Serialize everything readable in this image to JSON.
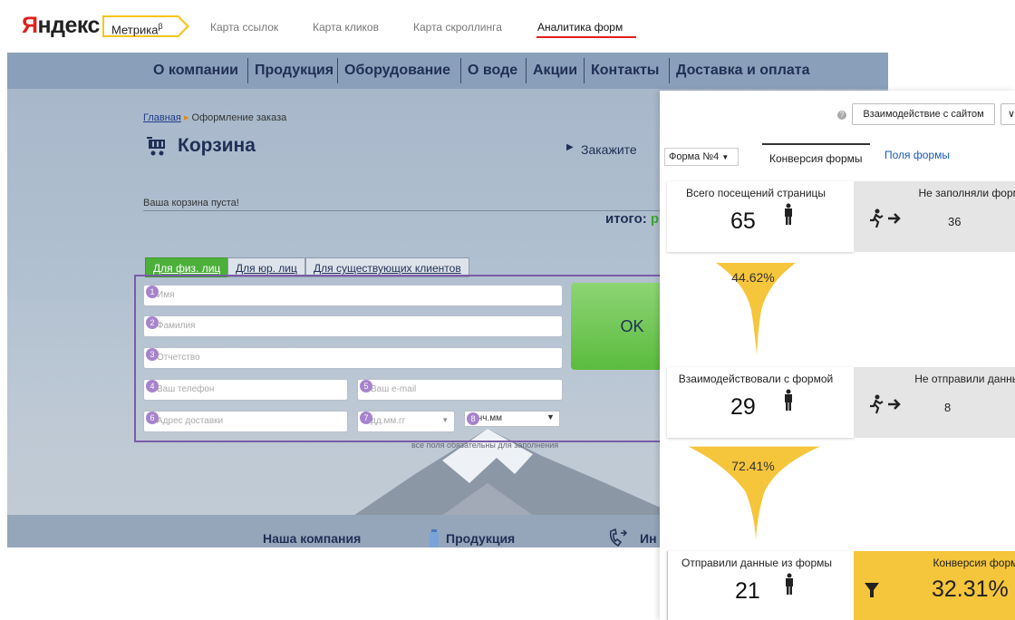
{
  "brand": {
    "logo_first": "Я",
    "logo_rest": "ндекс",
    "product": "Метрика",
    "product_sup": "β"
  },
  "topnav": [
    "Карта ссылок",
    "Карта кликов",
    "Карта скроллинга",
    "Аналитика форм"
  ],
  "site": {
    "menu": [
      "О компании",
      "Продукция",
      "Оборудование",
      "О воде",
      "Акции",
      "Контакты",
      "Доставка и оплата"
    ],
    "breadcrumb": {
      "home": "Главная",
      "sep": "▸",
      "current": "Оформление заказа"
    },
    "page_title": "Корзина",
    "order_link": "Закажите",
    "empty_text": "Ваша корзина пуста!",
    "total_label": "итого:",
    "total_value": "р",
    "tabs": [
      "Для физ. лиц",
      "Для юр. лиц",
      "Для существующих клиентов"
    ],
    "fields": {
      "f1": {
        "num": "1",
        "placeholder": "Имя"
      },
      "f2": {
        "num": "2",
        "placeholder": "Фамилия"
      },
      "f3": {
        "num": "3",
        "placeholder": "Отчетство"
      },
      "f4": {
        "num": "4",
        "placeholder": "Ваш телефон"
      },
      "f5": {
        "num": "5",
        "placeholder": "Ваш e-mail"
      },
      "f6": {
        "num": "6",
        "placeholder": "Адрес доставки"
      },
      "f7": {
        "num": "7",
        "placeholder": "дд.мм.гг"
      },
      "f8": {
        "num": "8",
        "placeholder": "чч.мм"
      }
    },
    "ok_button": "OK",
    "required_note": "все поля обязательны для заполнения",
    "footer": [
      "Наша компания",
      "Продукция",
      "Ин"
    ]
  },
  "panel": {
    "interaction_button": "Взаимодействие с сайтом",
    "dropdown_glyph": "∨",
    "help_glyph": "?",
    "form_select": "Форма №4",
    "tab_conversion": "Конверсия формы",
    "tab_fields": "Поля формы",
    "stage1": {
      "label": "Всего посещений страницы",
      "value": "65",
      "drop_label": "Не заполняли форму",
      "drop_value": "36"
    },
    "funnel1_pct": "44.62%",
    "stage2": {
      "label": "Взаимодействовали с формой",
      "value": "29",
      "drop_label": "Не отправили данные",
      "drop_value": "8"
    },
    "funnel2_pct": "72.41%",
    "stage3": {
      "label": "Отправили данные из формы",
      "value": "21"
    },
    "conversion": {
      "label": "Конверсия формы",
      "value": "32.31%"
    },
    "colors": {
      "funnel": "#f5c53b",
      "accent": "#e0201c"
    }
  }
}
